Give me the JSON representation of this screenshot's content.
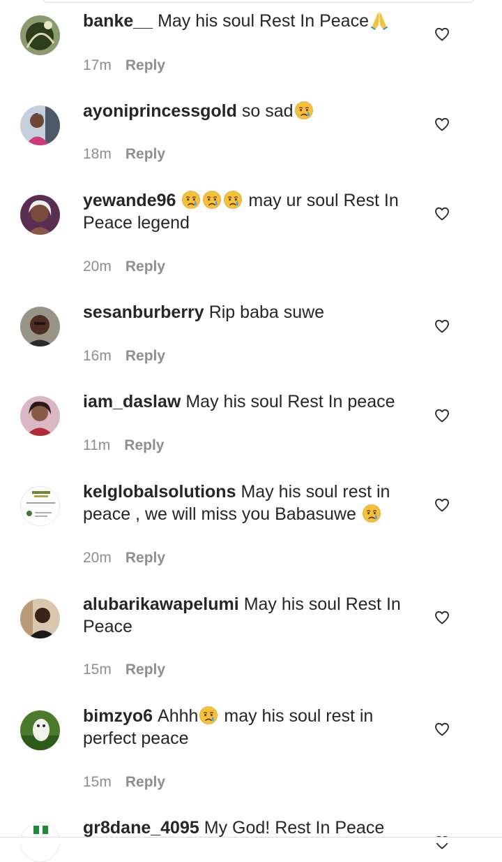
{
  "comments": [
    {
      "username": "banke__",
      "text": "May his soul Rest In Peace",
      "trailing_emoji": "folded-hands",
      "time": "17m",
      "reply_label": "Reply",
      "avatar": "dark-green"
    },
    {
      "username": "ayoniprincessgold",
      "text": "so sad",
      "trailing_emoji": "crying-face",
      "time": "18m",
      "reply_label": "Reply",
      "avatar": "woman-pink"
    },
    {
      "username": "yewande96",
      "text_line1": "may ur soul Rest In",
      "text_line2": "Peace legend",
      "leading_emojis": [
        "crying-face",
        "crying-face",
        "crying-face"
      ],
      "time": "20m",
      "reply_label": "Reply",
      "avatar": "woman-dark"
    },
    {
      "username": "sesanburberry",
      "text": "Rip baba suwe",
      "time": "16m",
      "reply_label": "Reply",
      "avatar": "man-face"
    },
    {
      "username": "iam_daslaw",
      "text": "May his soul Rest In peace",
      "time": "11m",
      "reply_label": "Reply",
      "avatar": "woman-red"
    },
    {
      "username": "kelglobalsolutions",
      "text_line1": "May his soul rest in",
      "text_line2": "peace , we will miss you Babasuwe",
      "trailing_emoji": "crying-face",
      "time": "20m",
      "reply_label": "Reply",
      "avatar": "logo-white"
    },
    {
      "username": "alubarikawapelumi",
      "text_line1": "May his soul Rest In",
      "text_line2": "Peace",
      "time": "15m",
      "reply_label": "Reply",
      "avatar": "man-beige"
    },
    {
      "username": "bimzyo6",
      "text_before": "Ahhh",
      "inline_emoji": "crying-face",
      "text_line1": "may his soul rest in",
      "text_line2": "perfect peace",
      "time": "15m",
      "reply_label": "Reply",
      "avatar": "owl-green"
    },
    {
      "username": "gr8dane_4095",
      "text": "My God! Rest In Peace",
      "avatar": "flag-green"
    }
  ],
  "colors": {
    "text": "#262626",
    "secondary": "#8e8e8e",
    "background": "#ffffff",
    "border": "#dbdbdb"
  },
  "icons": {
    "like": "heart-outline-icon",
    "folded_hands": "folded-hands-emoji",
    "crying": "crying-face-emoji"
  }
}
